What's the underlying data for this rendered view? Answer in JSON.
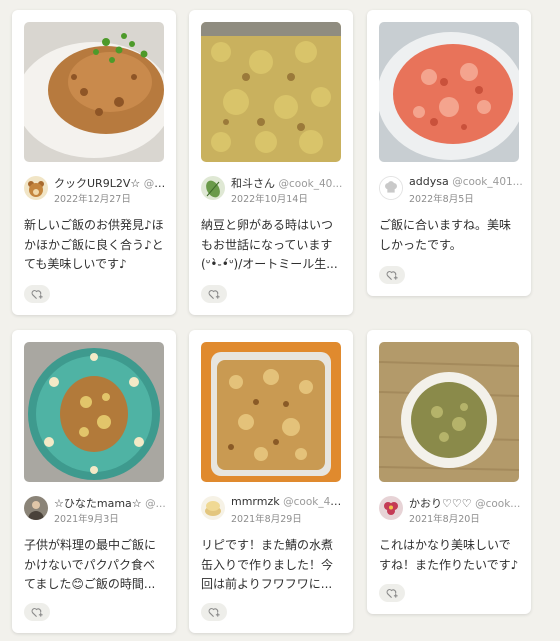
{
  "cards": [
    {
      "name": "クックUR9L2V☆",
      "handle": "@c...",
      "date": "2022年12月27日",
      "comment": "新しいご飯のお供発見♪ほかほかご飯に良く合う♪とても美味しいです♪",
      "photo": "rice-bowl-with-green-onions",
      "avatar": "bear-avatar"
    },
    {
      "name": "和斗さん",
      "handle": "@cook_40...",
      "date": "2022年10月14日",
      "comment": "納豆と卵がある時はいつもお世話になっています(ᐡ•̀֊•́ᐡ)/オートミール生...",
      "photo": "tray-of-scrambled-mix",
      "avatar": "leaf-avatar"
    },
    {
      "name": "addysa",
      "handle": "@cook_401...",
      "date": "2022年8月5日",
      "comment": "ご飯に合いますね。美味しかったです。",
      "photo": "red-salmon-flakes-bowl",
      "avatar": "chef-hat-avatar"
    },
    {
      "name": "☆ひなたmama☆",
      "handle": "@...",
      "date": "2021年9月3日",
      "comment": "子供が料理の最中ご飯にかけないでパクパク食べてました😊ご飯の時間...",
      "photo": "patterned-blue-bowl",
      "avatar": "person-avatar"
    },
    {
      "name": "mmrmzk",
      "handle": "@cook_41...",
      "date": "2021年8月29日",
      "comment": "リピです！また鯖の水煮缶入りで作りました！今回は前よりフワフワに...",
      "photo": "plastic-container-flakes",
      "avatar": "buns-avatar"
    },
    {
      "name": "かおり♡♡♡",
      "handle": "@cook...",
      "date": "2021年8月20日",
      "comment": "これはかなり美味しいですね！また作りたいです♪",
      "photo": "green-soup-bowl",
      "avatar": "flower-avatar"
    }
  ],
  "colors": {
    "background": "#f2f1ec",
    "card": "#ffffff",
    "like_button": "#eeeeea",
    "icon": "#8a8a8a"
  }
}
